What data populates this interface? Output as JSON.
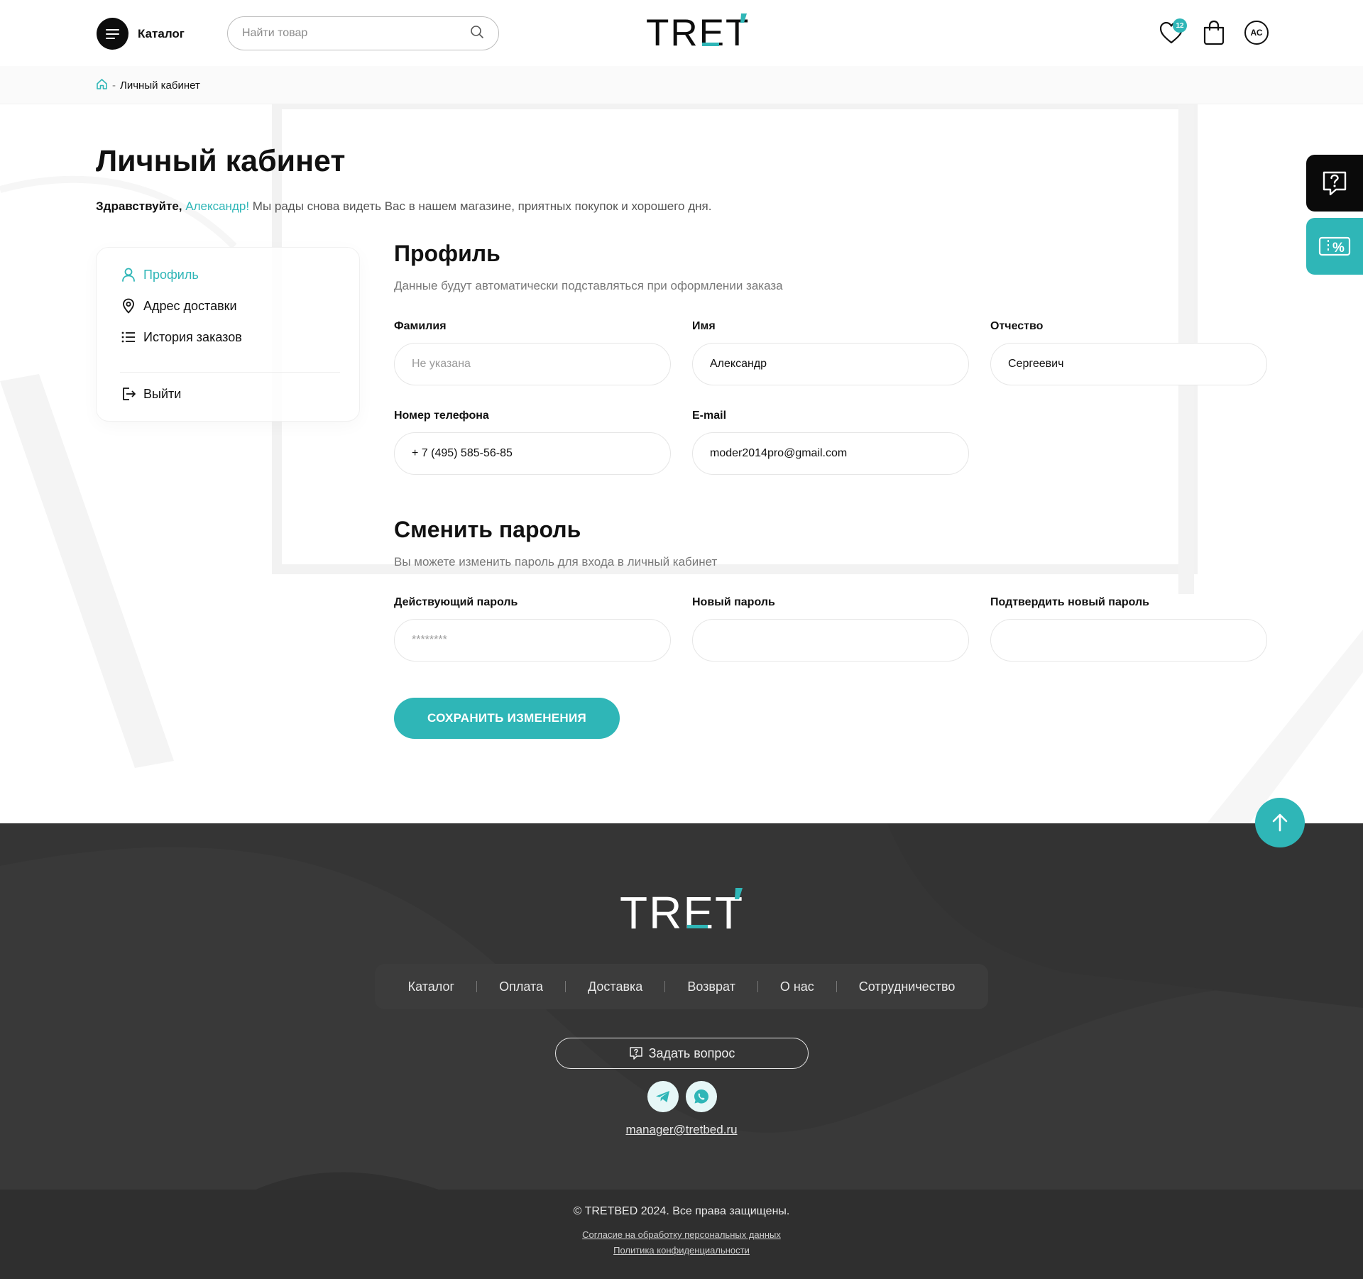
{
  "header": {
    "catalog_label": "Каталог",
    "search_placeholder": "Найти товар",
    "logo_text": "TRET",
    "favorites_count": "12",
    "avatar_initials": "АС"
  },
  "breadcrumb": {
    "current": "Личный кабинет"
  },
  "page": {
    "title": "Личный кабинет",
    "greeting_prefix": "Здравствуйте,",
    "greeting_name": "Александр!",
    "greeting_text": "Мы рады снова видеть Вас в нашем магазине, приятных покупок и хорошего дня."
  },
  "side_menu": {
    "items": [
      {
        "label": "Профиль",
        "icon": "user-icon",
        "active": true
      },
      {
        "label": "Адрес доставки",
        "icon": "map-pin-icon",
        "active": false
      },
      {
        "label": "История заказов",
        "icon": "list-icon",
        "active": false
      }
    ],
    "logout": "Выйти"
  },
  "profile": {
    "title": "Профиль",
    "subtitle": "Данные будут автоматически подставляться при оформлении заказа",
    "fields": {
      "last_name": {
        "label": "Фамилия",
        "value": "",
        "placeholder": "Не указана"
      },
      "first_name": {
        "label": "Имя",
        "value": "Александр",
        "placeholder": ""
      },
      "patronymic": {
        "label": "Отчество",
        "value": "Сергеевич",
        "placeholder": ""
      },
      "phone": {
        "label": "Номер телефона",
        "value": "+ 7 (495) 585-56-85",
        "placeholder": ""
      },
      "email": {
        "label": "E-mail",
        "value": "moder2014pro@gmail.com",
        "placeholder": ""
      }
    }
  },
  "password": {
    "title": "Сменить пароль",
    "subtitle": "Вы можете изменить пароль для входа в личный кабинет",
    "fields": {
      "current": {
        "label": "Действующий пароль",
        "placeholder": "********"
      },
      "new": {
        "label": "Новый пароль",
        "placeholder": ""
      },
      "confirm": {
        "label": "Подтвердить новый пароль",
        "placeholder": ""
      }
    }
  },
  "save_button": "СОХРАНИТЬ ИЗМЕНЕНИЯ",
  "footer": {
    "logo_text": "TRET",
    "nav": [
      "Каталог",
      "Оплата",
      "Доставка",
      "Возврат",
      "О нас",
      "Сотрудничество"
    ],
    "ask_button": "Задать вопрос",
    "socials": [
      "telegram-icon",
      "whatsapp-icon"
    ],
    "email": "manager@tretbed.ru",
    "copyright": "© TRETBED 2024. Все права защищены.",
    "consent_link": "Согласие на обработку персональных данных",
    "privacy_link": "Политика конфиденциальности"
  },
  "colors": {
    "accent": "#2fb6b7",
    "dark": "#0a0a0a",
    "footer_bg": "#353535"
  }
}
